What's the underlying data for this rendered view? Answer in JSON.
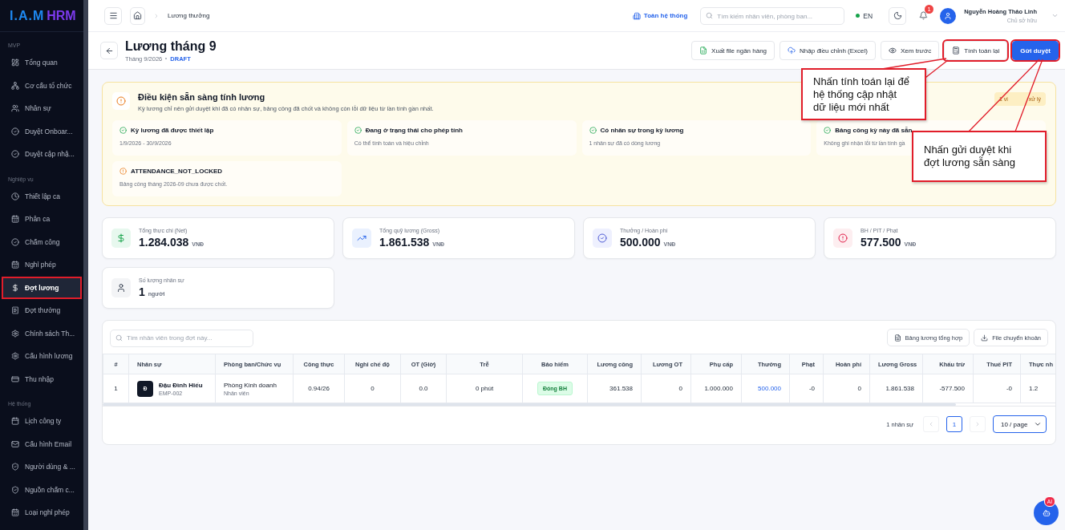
{
  "sidebar": {
    "logo": {
      "part_1": "I.A.M",
      "part_2": "HRM"
    },
    "sections": [
      {
        "title": "MVP",
        "items": [
          {
            "label": "Tổng quan",
            "selected": false,
            "highlighted": false
          },
          {
            "label": "Cơ cấu tổ chức",
            "selected": false,
            "highlighted": false
          },
          {
            "label": "Nhân sự",
            "selected": false,
            "highlighted": false
          },
          {
            "label": "Duyệt Onboar...",
            "selected": false,
            "highlighted": false
          },
          {
            "label": "Duyệt cập nhậ...",
            "selected": false,
            "highlighted": false
          }
        ]
      },
      {
        "title": "Nghiệp vụ",
        "items": [
          {
            "label": "Thiết lập ca",
            "selected": false,
            "highlighted": false
          },
          {
            "label": "Phân ca",
            "selected": false,
            "highlighted": false
          },
          {
            "label": "Chấm công",
            "selected": false,
            "highlighted": false
          },
          {
            "label": "Nghỉ phép",
            "selected": false,
            "highlighted": false
          },
          {
            "label": "Đợt lương",
            "selected": true,
            "highlighted": true
          },
          {
            "label": "Đợt thưởng",
            "selected": false,
            "highlighted": false
          },
          {
            "label": "Chính sách Th...",
            "selected": false,
            "highlighted": false
          },
          {
            "label": "Cấu hình lương",
            "selected": false,
            "highlighted": false
          },
          {
            "label": "Thu nhập",
            "selected": false,
            "highlighted": false
          }
        ]
      },
      {
        "title": "Hệ thống",
        "items": [
          {
            "label": "Lịch công ty",
            "selected": false,
            "highlighted": false
          },
          {
            "label": "Cấu hình Email",
            "selected": false,
            "highlighted": false
          },
          {
            "label": "Người dùng & ...",
            "selected": false,
            "highlighted": false
          },
          {
            "label": "Nguồn chấm c...",
            "selected": false,
            "highlighted": false
          },
          {
            "label": "Loại nghỉ phép",
            "selected": false,
            "highlighted": false
          }
        ]
      }
    ]
  },
  "topbar": {
    "breadcrumb": "Lương thưởng",
    "scope_link": "Toàn hệ thống",
    "search": {
      "placeholder": "Tìm kiếm nhân viên, phòng ban..."
    },
    "language": {
      "label": "EN",
      "on": true
    },
    "notification_count": "1",
    "user": {
      "name": "Nguyễn Hoàng Thảo Linh",
      "role": "Chủ sở hữu"
    }
  },
  "header": {
    "title": "Lương tháng 9",
    "period": "Tháng 9/2026",
    "status": "DRAFT",
    "actions": [
      {
        "label": "Xuất file ngân hàng",
        "kind": "outline",
        "highlighted": false
      },
      {
        "label": "Nhập điều chỉnh (Excel)",
        "kind": "outline",
        "highlighted": false
      },
      {
        "label": "Xem trước",
        "kind": "outline",
        "highlighted": false
      },
      {
        "label": "Tính toán lại",
        "kind": "outline",
        "highlighted": true
      },
      {
        "label": "Gửi duyệt",
        "kind": "primary",
        "highlighted": true
      }
    ]
  },
  "readiness": {
    "title": "Điều kiện sẵn sàng tính lương",
    "description": "Kỳ lương chỉ nên gửi duyệt khi đã có nhân sự, bảng công đã chốt và không còn lỗi dữ liệu từ lần tính gần nhất.",
    "badge": {
      "part_1": "1 vi",
      "part_2": "xử lý"
    },
    "items": [
      {
        "kind": "ok",
        "title": "Kỳ lương đã được thiết lập",
        "detail": "1/9/2026 - 30/9/2026"
      },
      {
        "kind": "ok",
        "title": "Đang ở trạng thái cho phép tính",
        "detail": "Có thể tính toán và hiệu chỉnh"
      },
      {
        "kind": "ok",
        "title": "Có nhân sự trong kỳ lương",
        "detail": "1 nhân sự đã có dòng lương"
      },
      {
        "kind": "ok",
        "title": "Bảng công kỳ này đã sẵn",
        "detail": "Không ghi nhận lỗi từ lần tính gầ"
      },
      {
        "kind": "warn",
        "title": "ATTENDANCE_NOT_LOCKED",
        "detail": "Bảng công tháng 2026-09 chưa được chốt."
      }
    ]
  },
  "stats": [
    {
      "kind": "net",
      "label": "Tổng thực chi (Net)",
      "value": "1.284.038",
      "unit": "VNĐ"
    },
    {
      "kind": "gross",
      "label": "Tổng quỹ lương (Gross)",
      "value": "1.861.538",
      "unit": "VNĐ"
    },
    {
      "kind": "bonus",
      "label": "Thưởng / Hoàn phí",
      "value": "500.000",
      "unit": "VNĐ"
    },
    {
      "kind": "deduction",
      "label": "BH / PIT / Phạt",
      "value": "577.500",
      "unit": "VNĐ"
    },
    {
      "kind": "people",
      "label": "Số lượng nhân sự",
      "value": "1",
      "unit": "người"
    }
  ],
  "table": {
    "search": {
      "placeholder": "Tìm nhân viên trong đợt này..."
    },
    "buttons": [
      "Bảng lương tổng hợp",
      "File chuyển khoản"
    ],
    "columns": [
      "#",
      "Nhân sự",
      "Phòng ban/Chức vụ",
      "Công thực",
      "Nghỉ chế độ",
      "OT (Giờ)",
      "Trễ",
      "Bảo hiểm",
      "Lương công",
      "Lương OT",
      "Phụ cấp",
      "Thưởng",
      "Phạt",
      "Hoàn phí",
      "Lương Gross",
      "Khấu trừ",
      "Thuế PIT",
      "Thực nh"
    ],
    "rows": [
      {
        "cells": [
          {
            "kind": "text",
            "text": "1"
          },
          {
            "kind": "employee",
            "initial": "Đ",
            "name": "Đậu Đình Hiếu",
            "code": "EMP-002"
          },
          {
            "kind": "department",
            "name": "Phòng Kinh doanh",
            "position": "Nhân viên"
          },
          {
            "kind": "text",
            "text": "0.94/26"
          },
          {
            "kind": "text",
            "text": "0"
          },
          {
            "kind": "text",
            "text": "0.0"
          },
          {
            "kind": "text",
            "text": "0 phút"
          },
          {
            "kind": "badge",
            "text": "Đóng BH"
          },
          {
            "kind": "text",
            "text": "361.538"
          },
          {
            "kind": "text",
            "text": "0"
          },
          {
            "kind": "text",
            "text": "1.000.000"
          },
          {
            "kind": "link",
            "text": "500.000"
          },
          {
            "kind": "text",
            "text": "-0"
          },
          {
            "kind": "text",
            "text": "0"
          },
          {
            "kind": "text",
            "text": "1.861.538"
          },
          {
            "kind": "text",
            "text": "-577.500"
          },
          {
            "kind": "text",
            "text": "-0"
          },
          {
            "kind": "text",
            "text": "1.2"
          }
        ]
      }
    ],
    "count": "1 nhân sự",
    "pages": [
      {
        "label": "1",
        "selected": true
      }
    ],
    "page_size": "10 / page"
  },
  "assistant": {
    "badge": "AI"
  },
  "annotations": [
    {
      "text": "Nhấn tính toán lại để hệ thống cập nhật dữ liệu mới nhất"
    },
    {
      "text": "Nhấn gửi duyệt khi đợt lương sẵn sàng"
    }
  ]
}
